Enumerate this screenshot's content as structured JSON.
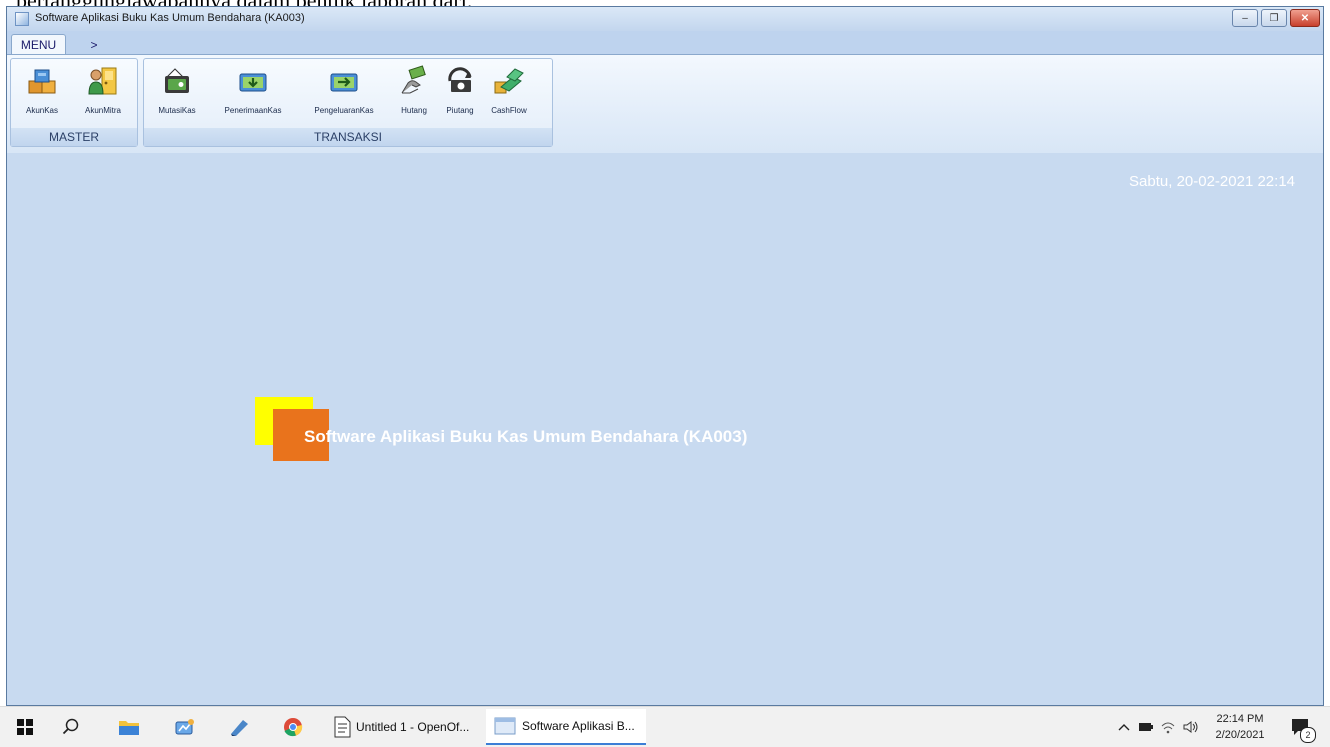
{
  "background_text": "pertanggungjawabannya dalam bentuk laporan dari.",
  "window": {
    "title": "Software Aplikasi Buku Kas Umum Bendahara (KA003)",
    "controls": {
      "minimize": "–",
      "restore": "❐",
      "close": "✕"
    }
  },
  "menu_tabs": [
    {
      "label": "MENU",
      "active": true
    },
    {
      "label": ">",
      "active": false
    }
  ],
  "ribbon": {
    "groups": [
      {
        "label": "MASTER",
        "buttons": [
          {
            "label": "AkunKas",
            "icon": "boxes-icon"
          },
          {
            "label": "AkunMitra",
            "icon": "person-door-icon"
          }
        ]
      },
      {
        "label": "TRANSAKSI",
        "buttons": [
          {
            "label": "MutasiKas",
            "icon": "wallet-icon"
          },
          {
            "label": "PenerimaanKas",
            "icon": "cash-in-icon"
          },
          {
            "label": "PengeluaranKas",
            "icon": "cash-out-icon"
          },
          {
            "label": "Hutang",
            "icon": "hand-money-icon"
          },
          {
            "label": "Piutang",
            "icon": "money-return-icon"
          },
          {
            "label": "CashFlow",
            "icon": "cashflow-icon"
          }
        ]
      }
    ]
  },
  "main": {
    "datetime": "Sabtu, 20-02-2021 22:14",
    "app_name": "Software Aplikasi Buku Kas Umum Bendahara (KA003)",
    "logo_colors": {
      "square_back": "#ffff00",
      "square_front": "#e9731c"
    }
  },
  "taskbar": {
    "apps": [
      {
        "label": "Untitled 1 - OpenOf...",
        "active": false
      },
      {
        "label": "Software Aplikasi B...",
        "active": true
      }
    ],
    "time": "22:14 PM",
    "date": "2/20/2021",
    "notification_count": "2"
  }
}
